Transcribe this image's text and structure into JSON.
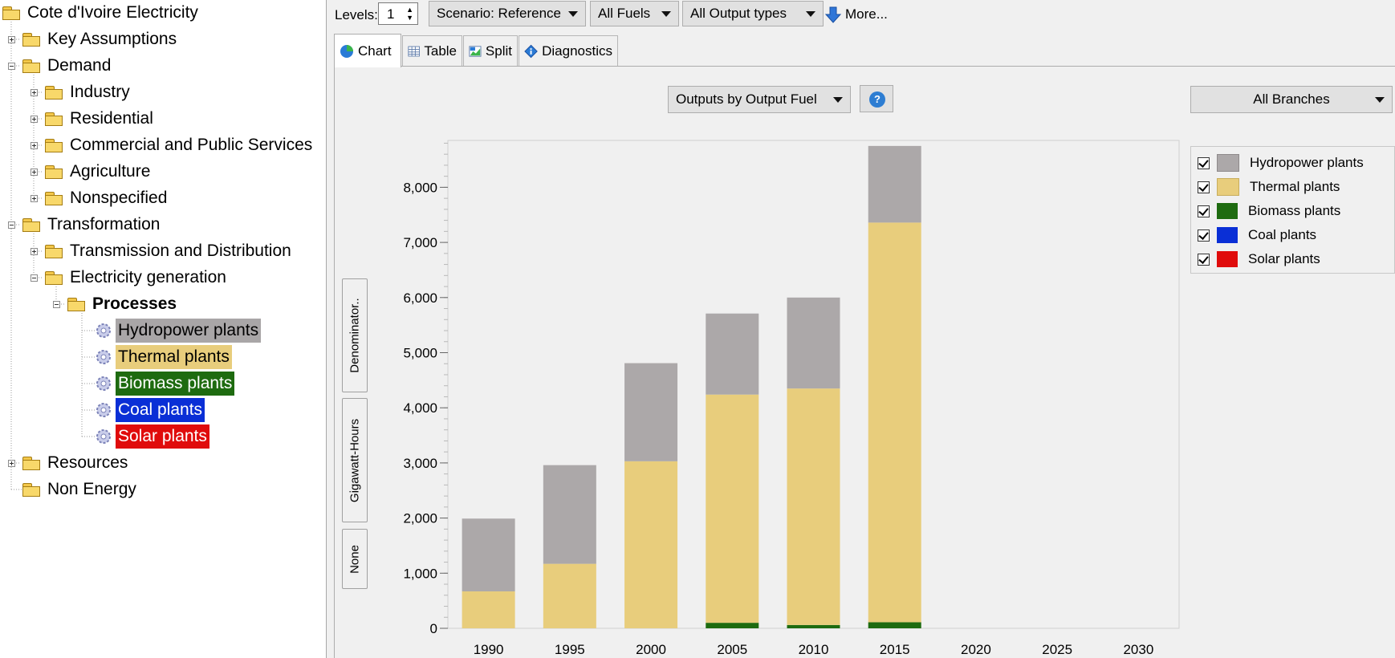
{
  "tree": {
    "root": "Cote d'Ivoire Electricity",
    "nodes": [
      {
        "label": "Key Assumptions"
      },
      {
        "label": "Demand"
      },
      {
        "label": "Industry"
      },
      {
        "label": "Residential"
      },
      {
        "label": "Commercial and Public Services"
      },
      {
        "label": "Agriculture"
      },
      {
        "label": "Nonspecified"
      },
      {
        "label": "Transformation"
      },
      {
        "label": "Transmission and Distribution"
      },
      {
        "label": "Electricity generation"
      },
      {
        "label": "Processes"
      },
      {
        "label": "Hydropower plants",
        "highlight": "#a9a6a7",
        "text_color": "#000000"
      },
      {
        "label": "Thermal plants",
        "highlight": "#e8cd7c",
        "text_color": "#000000"
      },
      {
        "label": "Biomass plants",
        "highlight": "#1e6b10",
        "text_color": "#ffffff"
      },
      {
        "label": "Coal plants",
        "highlight": "#0a2fd6",
        "text_color": "#ffffff"
      },
      {
        "label": "Solar plants",
        "highlight": "#e00c0c",
        "text_color": "#ffffff"
      },
      {
        "label": "Resources"
      },
      {
        "label": "Non Energy"
      }
    ]
  },
  "toolbar": {
    "levels_label": "Levels:",
    "levels_value": "1",
    "scenario": "Scenario: Reference",
    "fuels": "All Fuels",
    "output_types": "All Output types",
    "more": "More..."
  },
  "tabs": {
    "chart": "Chart",
    "table": "Table",
    "split": "Split",
    "diagnostics": "Diagnostics"
  },
  "controls": {
    "outputs_selector": "Outputs by Output Fuel",
    "branches_selector": "All Branches",
    "denominator": "Denominator..",
    "unit": "Gigawatt-Hours",
    "none": "None"
  },
  "colors": {
    "hydropower": "#aca8a9",
    "thermal": "#e8cd7c",
    "biomass": "#1e6b10",
    "coal": "#0a2fd6",
    "solar": "#e00c0c"
  },
  "chart_data": {
    "type": "bar",
    "stacked": true,
    "categories": [
      "1990",
      "1995",
      "2000",
      "2005",
      "2010",
      "2015",
      "2020",
      "2025",
      "2030"
    ],
    "y_ticks": [
      "0",
      "1,000",
      "2,000",
      "3,000",
      "4,000",
      "5,000",
      "6,000",
      "7,000",
      "8,000"
    ],
    "ylim": [
      0,
      8850
    ],
    "ylabel": "Gigawatt-Hours",
    "legend_position": "right",
    "series": [
      {
        "name": "Solar plants",
        "color": "#e00c0c",
        "values": [
          0,
          0,
          0,
          0,
          0,
          0,
          null,
          null,
          null
        ]
      },
      {
        "name": "Coal plants",
        "color": "#0a2fd6",
        "values": [
          0,
          0,
          0,
          0,
          0,
          0,
          null,
          null,
          null
        ]
      },
      {
        "name": "Biomass plants",
        "color": "#1e6b10",
        "values": [
          0,
          0,
          0,
          100,
          60,
          110,
          null,
          null,
          null
        ]
      },
      {
        "name": "Thermal plants",
        "color": "#e8cd7c",
        "values": [
          670,
          1170,
          3030,
          4140,
          4290,
          7250,
          null,
          null,
          null
        ]
      },
      {
        "name": "Hydropower plants",
        "color": "#aca8a9",
        "values": [
          1320,
          1790,
          1780,
          1470,
          1650,
          1390,
          null,
          null,
          null
        ]
      }
    ]
  },
  "legend": {
    "items": [
      "Hydropower plants",
      "Thermal plants",
      "Biomass plants",
      "Coal plants",
      "Solar plants"
    ]
  }
}
